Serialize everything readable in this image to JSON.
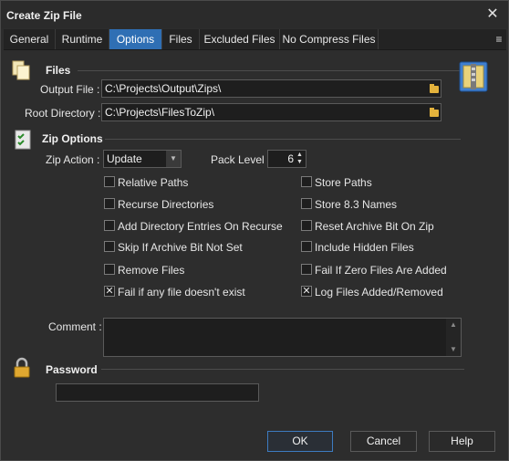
{
  "window": {
    "title": "Create Zip File",
    "close_glyph": "✕"
  },
  "tabs": [
    {
      "label": "General",
      "active": false
    },
    {
      "label": "Runtime",
      "active": false
    },
    {
      "label": "Options",
      "active": true
    },
    {
      "label": "Files",
      "active": false
    },
    {
      "label": "Excluded Files",
      "active": false
    },
    {
      "label": "No Compress Files",
      "active": false
    }
  ],
  "tab_menu_glyph": "≡",
  "files": {
    "section_label": "Files",
    "output_file_label": "Output File :",
    "output_file_value": "C:\\Projects\\Output\\Zips\\",
    "root_directory_label": "Root Directory :",
    "root_directory_value": "C:\\Projects\\FilesToZip\\"
  },
  "zip_options": {
    "section_label": "Zip Options",
    "zip_action_label": "Zip Action :",
    "zip_action_value": "Update",
    "pack_level_label": "Pack Level :",
    "pack_level_value": "6",
    "left_checks": [
      {
        "label": "Relative Paths",
        "checked": false
      },
      {
        "label": "Recurse Directories",
        "checked": false
      },
      {
        "label": "Add Directory Entries On Recurse",
        "checked": false
      },
      {
        "label": "Skip If Archive Bit Not Set",
        "checked": false
      },
      {
        "label": "Remove Files",
        "checked": false
      },
      {
        "label": "Fail if any file doesn't exist",
        "checked": true
      }
    ],
    "right_checks": [
      {
        "label": "Store Paths",
        "checked": false
      },
      {
        "label": "Store 8.3 Names",
        "checked": false
      },
      {
        "label": "Reset Archive Bit On Zip",
        "checked": false
      },
      {
        "label": "Include Hidden Files",
        "checked": false
      },
      {
        "label": "Fail If Zero Files Are Added",
        "checked": false
      },
      {
        "label": "Log Files Added/Removed",
        "checked": true
      }
    ],
    "check_mark": "✕",
    "comment_label": "Comment :",
    "comment_value": ""
  },
  "password": {
    "section_label": "Password",
    "value": ""
  },
  "buttons": {
    "ok": "OK",
    "cancel": "Cancel",
    "help": "Help"
  },
  "colors": {
    "accent": "#2f6fb4",
    "background": "#2d2d2d",
    "field": "#1e1e1e"
  }
}
